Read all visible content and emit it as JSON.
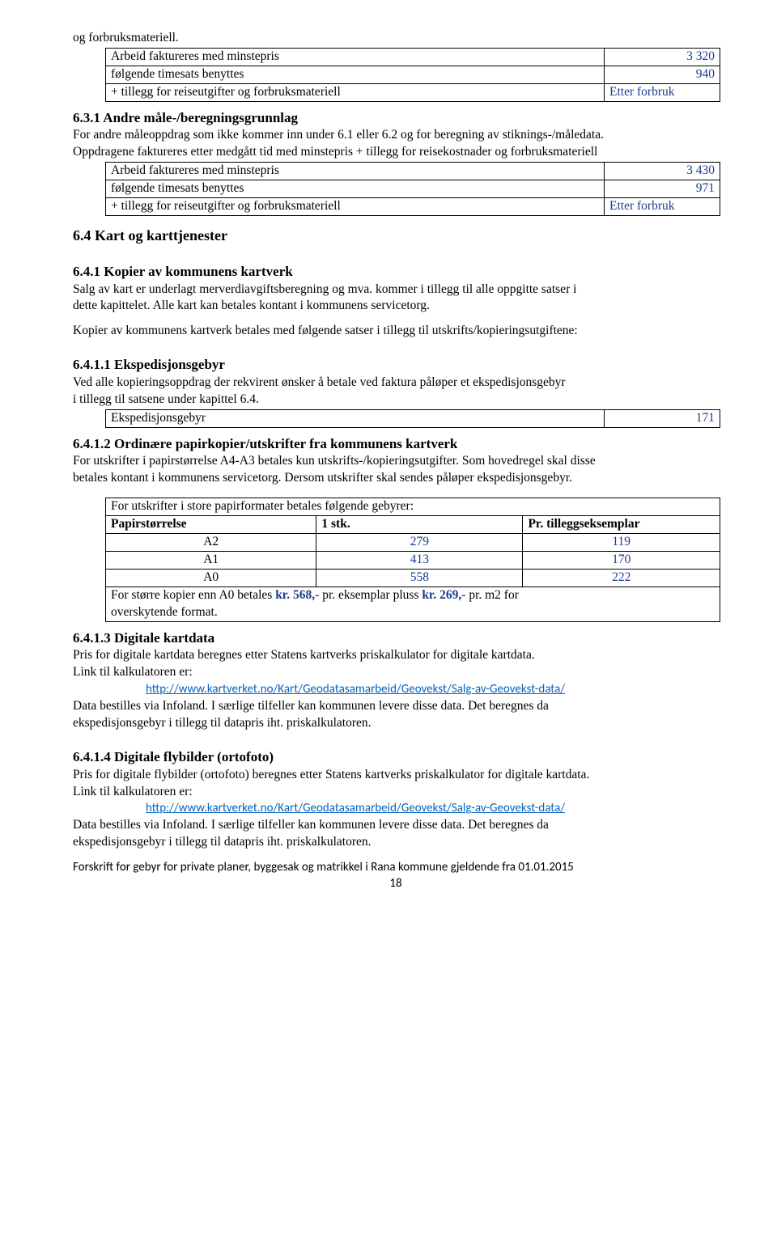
{
  "top": {
    "line1": "og forbruksmateriell.",
    "table1": {
      "r1c1": "Arbeid faktureres med minstepris",
      "r1c2": "3 320",
      "r2c1": "følgende timesats benyttes",
      "r2c2": "940",
      "r3c1": "+ tillegg for reiseutgifter og forbruksmateriell",
      "r3c2": "Etter forbruk"
    }
  },
  "s631": {
    "h": "6.3.1 Andre måle-/beregningsgrunnlag",
    "p1": "For andre måleoppdrag som ikke kommer inn under 6.1 eller 6.2 og for beregning av stiknings-/måledata.",
    "p2": "Oppdragene faktureres etter medgått tid med minstepris + tillegg for reisekostnader og forbruksmateriell",
    "table": {
      "r1c1": "Arbeid faktureres med minstepris",
      "r1c2": "3 430",
      "r2c1": "følgende timesats benyttes",
      "r2c2": "971",
      "r3c1": "+ tillegg for reiseutgifter og forbruksmateriell",
      "r3c2": "Etter forbruk"
    }
  },
  "s64": {
    "h": "6.4  Kart og karttjenester"
  },
  "s641": {
    "h": "6.4.1  Kopier av kommunens kartverk",
    "p1": "Salg av kart er underlagt merverdiavgiftsberegning og mva. kommer i tillegg til alle oppgitte satser i",
    "p2": "dette kapittelet. Alle kart kan betales kontant i kommunens servicetorg.",
    "p3": "Kopier av kommunens kartverk betales med følgende satser i tillegg til utskrifts/kopieringsutgiftene:"
  },
  "s6411": {
    "h": "6.4.1.1 Ekspedisjonsgebyr",
    "p1": "Ved alle kopieringsoppdrag der rekvirent ønsker å betale ved faktura påløper et ekspedisjonsgebyr",
    "p2": "i tillegg til satsene under kapittel 6.4.",
    "table": {
      "r1c1": "Ekspedisjonsgebyr",
      "r1c2": "171"
    }
  },
  "s6412": {
    "h": "6.4.1.2  Ordinære papirkopier/utskrifter fra kommunens kartverk",
    "p1": "For utskrifter i papirstørrelse A4-A3 betales kun utskrifts-/kopieringsutgifter. Som hovedregel skal disse",
    "p2": " betales kontant i kommunens servicetorg. Dersom utskrifter skal sendes påløper ekspedisjonsgebyr.",
    "tHeader": "For utskrifter i store papirformater betales følgende gebyrer:",
    "th1": "Papirstørrelse",
    "th2": "1 stk.",
    "th3": "Pr. tilleggseksemplar",
    "rows": [
      {
        "a": "A2",
        "b": "279",
        "c": "119"
      },
      {
        "a": "A1",
        "b": "413",
        "c": "170"
      },
      {
        "a": "A0",
        "b": "558",
        "c": "222"
      }
    ],
    "foot1a": "For større kopier enn A0 betales ",
    "foot1b": "kr. 568,-",
    "foot1c": " pr. eksemplar pluss ",
    "foot1d": "kr. 269,-",
    "foot1e": " pr. m2 for",
    "foot2": "overskytende format."
  },
  "s6413": {
    "h": "6.4.1.3  Digitale kartdata",
    "p1": "Pris for digitale kartdata beregnes etter Statens kartverks priskalkulator for digitale kartdata.",
    "p2": "Link til kalkulatoren er:",
    "link": "http://www.kartverket.no/Kart/Geodatasamarbeid/Geovekst/Salg-av-Geovekst-data/",
    "p3": "Data bestilles via Infoland. I særlige tilfeller kan kommunen levere disse data. Det beregnes da",
    "p4": "ekspedisjonsgebyr i tillegg til datapris iht. priskalkulatoren."
  },
  "s6414": {
    "h": "6.4.1.4  Digitale flybilder (ortofoto)",
    "p1": "Pris for digitale flybilder (ortofoto) beregnes etter Statens kartverks priskalkulator for digitale kartdata.",
    "p2": "Link til kalkulatoren er:",
    "link": "http://www.kartverket.no/Kart/Geodatasamarbeid/Geovekst/Salg-av-Geovekst-data/",
    "p3": "Data bestilles via Infoland. I særlige tilfeller kan kommunen levere disse data. Det beregnes da",
    "p4": "ekspedisjonsgebyr i tillegg til datapris iht. priskalkulatoren."
  },
  "footer": {
    "text": "Forskrift for gebyr for private planer, byggesak og matrikkel i Rana kommune gjeldende fra 01.01.2015",
    "page": "18"
  }
}
